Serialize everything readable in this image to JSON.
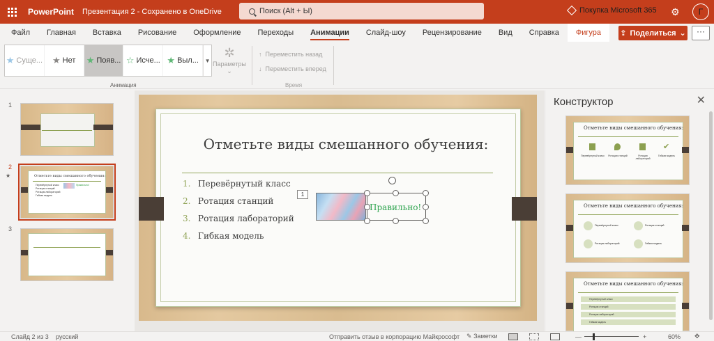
{
  "titlebar": {
    "app_name": "PowerPoint",
    "doc_title": "Презентация 2 - Сохранено в OneDrive",
    "search_placeholder": "Поиск (Alt + Ы)",
    "buy_label": "Покупка Microsoft 365",
    "avatar_initial": "Г",
    "bg_color": "#c43e1c"
  },
  "tabs": [
    {
      "label": "Файл"
    },
    {
      "label": "Главная"
    },
    {
      "label": "Вставка"
    },
    {
      "label": "Рисование"
    },
    {
      "label": "Оформление"
    },
    {
      "label": "Переходы"
    },
    {
      "label": "Анимации",
      "active": true
    },
    {
      "label": "Слайд-шоу"
    },
    {
      "label": "Рецензирование"
    },
    {
      "label": "Вид"
    },
    {
      "label": "Справка"
    },
    {
      "label": "Фигура"
    }
  ],
  "share_label": "Поделиться",
  "more_label": "···",
  "ribbon": {
    "animations": [
      {
        "label": "Суще..."
      },
      {
        "label": "Нет"
      },
      {
        "label": "Появ...",
        "selected": true
      },
      {
        "label": "Исче..."
      },
      {
        "label": "Выл..."
      }
    ],
    "animation_group_label": "Анимация",
    "params_label": "Параметры",
    "move_back_label": "Переместить назад",
    "move_forward_label": "Переместить вперед",
    "time_group_label": "Время"
  },
  "thumbnails": {
    "numbers": [
      "1",
      "2",
      "3"
    ],
    "selected": 2,
    "mini_title": "Отметьте виды смешанного обучения:",
    "mini_bullets": [
      "Перевёрнутый класс",
      "Ротация станций",
      "Ротация лабораторий",
      "Гибкая модель"
    ],
    "mini_correct": "Правильно!"
  },
  "slide": {
    "title": "Отметьте виды смешанного обучения:",
    "bullets": [
      {
        "num": "1.",
        "text": "Перевёрнутый класс"
      },
      {
        "num": "2.",
        "text": "Ротация станций"
      },
      {
        "num": "3.",
        "text": "Ротация лабораторий"
      },
      {
        "num": "4.",
        "text": "Гибкая модель"
      }
    ],
    "correct_text": "Правильно!",
    "animation_tag": "1"
  },
  "designer": {
    "title": "Конструктор",
    "thumb_title": "Отметьте виды смешанного обучения:",
    "labels": [
      "Перевёрнутый класс",
      "Ротация станций",
      "Ротация лабораторий",
      "Гибкая модель"
    ]
  },
  "status": {
    "slide_info": "Слайд 2 из 3",
    "language": "русский",
    "feedback": "Отправить отзыв в корпорацию Майкрософт",
    "notes": "Заметки",
    "zoom": "60%"
  }
}
